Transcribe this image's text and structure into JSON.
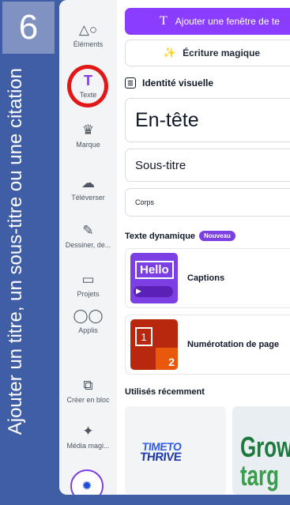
{
  "overlay": {
    "step_number": "6",
    "caption": "Ajouter un titre, un sous-titre ou une citation"
  },
  "rail": {
    "items": [
      {
        "id": "elements",
        "label": "Éléments",
        "icon": "shapes-icon"
      },
      {
        "id": "texte",
        "label": "Texte",
        "icon": "text-icon"
      },
      {
        "id": "marque",
        "label": "Marque",
        "icon": "crown-icon"
      },
      {
        "id": "televerser",
        "label": "Téléverser",
        "icon": "cloud-upload-icon"
      },
      {
        "id": "dessiner",
        "label": "Dessiner, de...",
        "icon": "pen-icon"
      },
      {
        "id": "projets",
        "label": "Projets",
        "icon": "folder-icon"
      },
      {
        "id": "applis",
        "label": "Applis",
        "icon": "apps-icon"
      },
      {
        "id": "creer",
        "label": "Créer en bloc",
        "icon": "bulk-create-icon"
      },
      {
        "id": "media",
        "label": "Média magi...",
        "icon": "magic-media-icon"
      }
    ],
    "active": "texte"
  },
  "panel": {
    "add_textbox_label": "Ajouter une fenêtre de te",
    "magic_write_label": "Écriture magique",
    "brand_section_title": "Identité visuelle",
    "heading_sample": "En-tête",
    "subheading_sample": "Sous-titre",
    "body_sample": "Corps",
    "dynamic_text_title": "Texte dynamique",
    "dynamic_badge": "Nouveau",
    "cards": [
      {
        "label": "Captions",
        "thumb_text": "Hello"
      },
      {
        "label": "Numérotation de page",
        "thumb_numbers": [
          "1",
          "2"
        ]
      }
    ],
    "recent_title": "Utilisés récemment",
    "recent_items": [
      {
        "line1": "TIMETO",
        "line2": "THRIVE"
      },
      {
        "line1": "Grow",
        "line2": "targ"
      }
    ]
  },
  "colors": {
    "accent": "#8b3dff",
    "overlay_bg": "#3f5ea6",
    "highlight": "#e21818"
  }
}
